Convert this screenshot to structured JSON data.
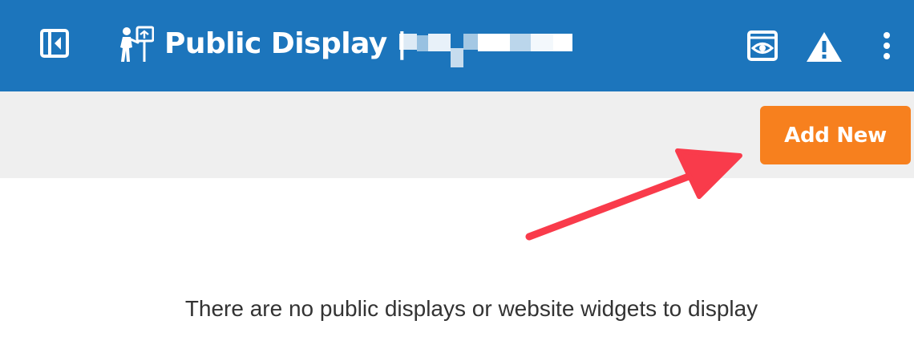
{
  "header": {
    "title": "Public Display |",
    "background_color": "#1c75bc",
    "icons": {
      "sidebar_toggle": "sidebar-collapse-icon",
      "title": "person-with-sign-icon",
      "preview": "eye-window-icon",
      "warning": "warning-triangle-icon",
      "more": "more-vertical-icon"
    }
  },
  "toolbar": {
    "add_new_label": "Add New",
    "add_new_color": "#f7801e"
  },
  "annotation": {
    "arrow_color": "#f93b4b"
  },
  "main": {
    "empty_message": "There are no public displays or website widgets to display"
  }
}
